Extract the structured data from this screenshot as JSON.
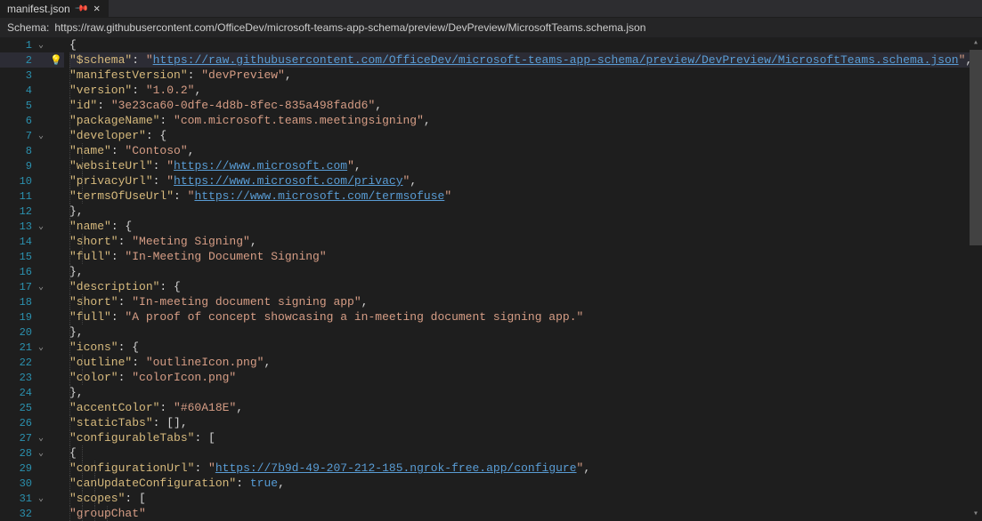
{
  "tab": {
    "filename": "manifest.json"
  },
  "schemaBar": {
    "label": "Schema:",
    "url": "https://raw.githubusercontent.com/OfficeDev/microsoft-teams-app-schema/preview/DevPreview/MicrosoftTeams.schema.json"
  },
  "code": {
    "schemaKey": "\"$schema\"",
    "schemaVal": "https://raw.githubusercontent.com/OfficeDev/microsoft-teams-app-schema/preview/DevPreview/MicrosoftTeams.schema.json",
    "manifestVersionKey": "\"manifestVersion\"",
    "manifestVersionVal": "\"devPreview\"",
    "versionKey": "\"version\"",
    "versionVal": "\"1.0.2\"",
    "idKey": "\"id\"",
    "idVal": "\"3e23ca60-0dfe-4d8b-8fec-835a498fadd6\"",
    "packageNameKey": "\"packageName\"",
    "packageNameVal": "\"com.microsoft.teams.meetingsigning\"",
    "developerKey": "\"developer\"",
    "devNameKey": "\"name\"",
    "devNameVal": "\"Contoso\"",
    "devWebsiteKey": "\"websiteUrl\"",
    "devWebsiteVal": "https://www.microsoft.com",
    "devPrivacyKey": "\"privacyUrl\"",
    "devPrivacyVal": "https://www.microsoft.com/privacy",
    "devTermsKey": "\"termsOfUseUrl\"",
    "devTermsVal": "https://www.microsoft.com/termsofuse",
    "nameKey": "\"name\"",
    "nameShortKey": "\"short\"",
    "nameShortVal": "\"Meeting Signing\"",
    "nameFullKey": "\"full\"",
    "nameFullVal": "\"In-Meeting Document Signing\"",
    "descKey": "\"description\"",
    "descShortKey": "\"short\"",
    "descShortVal": "\"In-meeting document signing app\"",
    "descFullKey": "\"full\"",
    "descFullVal": "\"A proof of concept showcasing a in-meeting document signing app.\"",
    "iconsKey": "\"icons\"",
    "iconsOutlineKey": "\"outline\"",
    "iconsOutlineVal": "\"outlineIcon.png\"",
    "iconsColorKey": "\"color\"",
    "iconsColorVal": "\"colorIcon.png\"",
    "accentColorKey": "\"accentColor\"",
    "accentColorVal": "\"#60A18E\"",
    "staticTabsKey": "\"staticTabs\"",
    "configTabsKey": "\"configurableTabs\"",
    "configUrlKey": "\"configurationUrl\"",
    "configUrlVal": "https://7b9d-49-207-212-185.ngrok-free.app/configure",
    "canUpdateKey": "\"canUpdateConfiguration\"",
    "canUpdateVal": "true",
    "scopesKey": "\"scopes\"",
    "scopesVal": "\"groupChat\""
  },
  "lineNumbers": [
    "1",
    "2",
    "3",
    "4",
    "5",
    "6",
    "7",
    "8",
    "9",
    "10",
    "11",
    "12",
    "13",
    "14",
    "15",
    "16",
    "17",
    "18",
    "19",
    "20",
    "21",
    "22",
    "23",
    "24",
    "25",
    "26",
    "27",
    "28",
    "29",
    "30",
    "31",
    "32"
  ]
}
